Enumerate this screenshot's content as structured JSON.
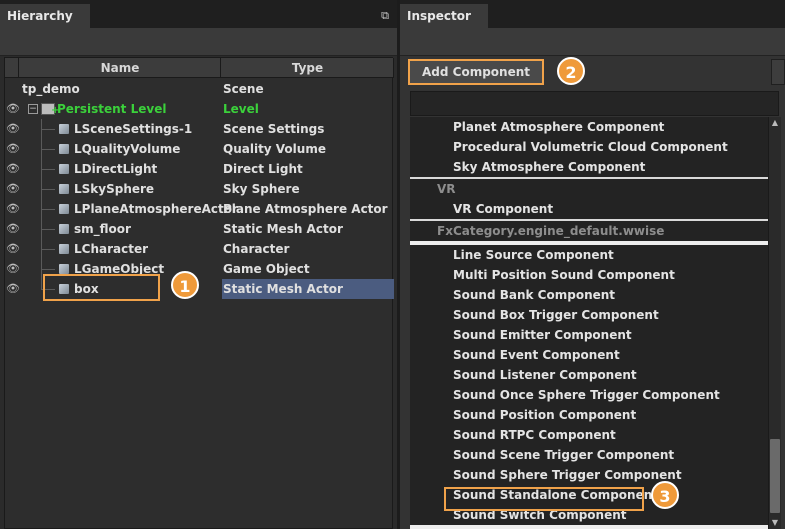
{
  "hierarchy": {
    "tab_title": "Hierarchy",
    "pin_icon": "⧉",
    "columns": {
      "name": "Name",
      "type": "Type"
    },
    "rows": [
      {
        "name": "tp_demo",
        "type": "Scene"
      },
      {
        "name": "Persistent Level",
        "type": "Level"
      },
      {
        "name": "LSceneSettings-1",
        "type": "Scene Settings"
      },
      {
        "name": "LQualityVolume",
        "type": "Quality Volume"
      },
      {
        "name": "LDirectLight",
        "type": "Direct Light"
      },
      {
        "name": "LSkySphere",
        "type": "Sky Sphere"
      },
      {
        "name": "LPlaneAtmosphereActor",
        "type": "Plane Atmosphere Actor"
      },
      {
        "name": "sm_floor",
        "type": "Static Mesh Actor"
      },
      {
        "name": "LCharacter",
        "type": "Character"
      },
      {
        "name": "LGameObject",
        "type": "Game Object"
      },
      {
        "name": "box",
        "type": "Static Mesh Actor"
      }
    ],
    "eye_icon": "👁",
    "expander": "−",
    "level_plus": "+"
  },
  "inspector": {
    "tab_title": "Inspector",
    "add_component_label": "Add Component",
    "components_top": [
      "Planet Atmosphere Component",
      "Procedural Volumetric Cloud Component",
      "Sky Atmosphere Component"
    ],
    "category_vr": "VR",
    "components_vr": [
      "VR Component"
    ],
    "category_wwise": "FxCategory.engine_default.wwise",
    "components_wwise": [
      "Line Source Component",
      "Multi Position Sound Component",
      "Sound Bank Component",
      "Sound Box Trigger Component",
      "Sound Emitter Component",
      "Sound Event Component",
      "Sound Listener Component",
      "Sound Once Sphere Trigger Component",
      "Sound Position Component",
      "Sound RTPC Component",
      "Sound Scene Trigger Component",
      "Sound Sphere Trigger Component",
      "Sound Standalone Component",
      "Sound Switch Component"
    ],
    "scroll_up": "▲",
    "scroll_down": "▼"
  },
  "callouts": [
    "1",
    "2",
    "3"
  ],
  "colors": {
    "accent_orange": "#f0a24a",
    "selection_blue": "#4b5c80",
    "level_green": "#3bd13b"
  }
}
